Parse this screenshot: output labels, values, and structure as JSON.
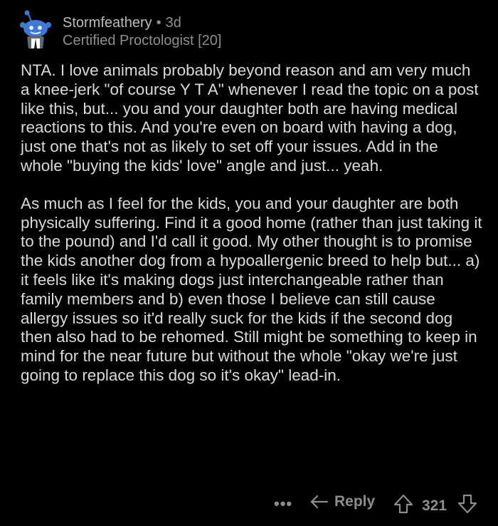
{
  "comment": {
    "author": "Stormfeathery",
    "separator": "•",
    "age": "3d",
    "flair": "Certified Proctologist [20]",
    "paragraphs": [
      "NTA. I love animals probably beyond reason and am very much a knee-jerk \"of course Y T A\" whenever I read the topic on a post like this, but... you and your daughter both are having medical reactions to this. And you're even on board with having a dog, just one that's not as likely to set off your issues. Add in the whole \"buying the kids' love\" angle and just... yeah.",
      "As much as I feel for the kids, you and your daughter are both physically suffering. Find it a good home (rather than just taking it to the pound) and I'd call it good. My other thought is to promise the kids another dog from a hypoallergenic breed to help but... a) it feels like it's making dogs just interchangeable rather than family members and b) even those I believe can still cause allergy issues so it'd really suck for the kids if the second dog then also had to be rehomed. Still might be something to keep in mind for the near future but without the whole \"okay we're just going to replace this dog so it's okay\" lead-in."
    ]
  },
  "actions": {
    "more_label": "•••",
    "reply_label": "Reply",
    "score": "321"
  },
  "icons": {
    "avatar": "snoo-avatar-icon",
    "more": "more-options-icon",
    "reply": "reply-arrow-icon",
    "upvote": "upvote-arrow-icon",
    "downvote": "downvote-arrow-icon"
  },
  "colors": {
    "background": "#000000",
    "text": "#d7dadc",
    "muted": "#8b8e90",
    "avatar_blue": "#3d7ad6"
  }
}
